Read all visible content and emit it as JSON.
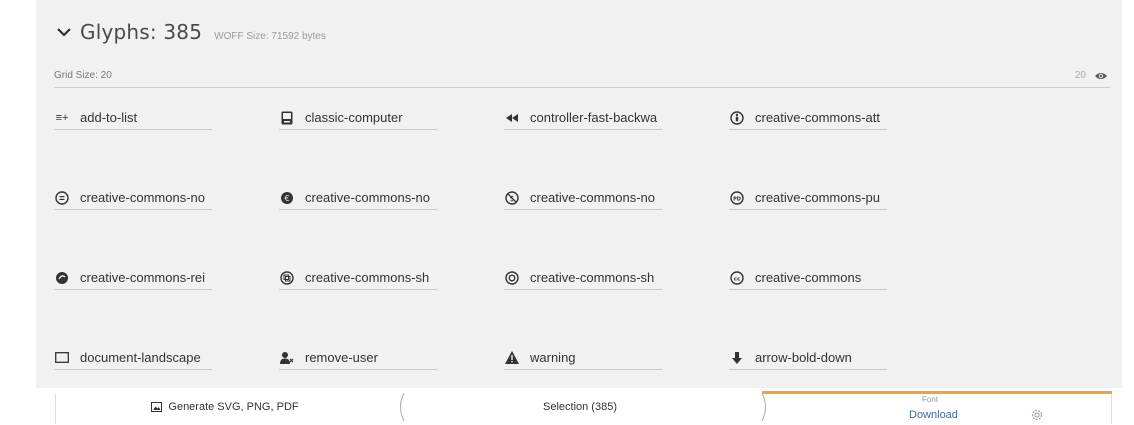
{
  "header": {
    "title": "Glyphs: 385",
    "woff_label": "WOFF Size: 71592 bytes"
  },
  "grid": {
    "label": "Grid Size: 20",
    "value": "20"
  },
  "glyphs": [
    {
      "name": "add-to-list",
      "icon": "add-to-list-icon"
    },
    {
      "name": "classic-computer",
      "icon": "classic-computer-icon"
    },
    {
      "name": "controller-fast-backwa",
      "icon": "controller-fast-backward-icon"
    },
    {
      "name": "creative-commons-att",
      "icon": "creative-commons-attribution-icon"
    },
    {
      "name": "creative-commons-no",
      "icon": "creative-commons-noderivs-icon"
    },
    {
      "name": "creative-commons-no",
      "icon": "creative-commons-noncommercial-eu-icon"
    },
    {
      "name": "creative-commons-no",
      "icon": "creative-commons-noncommercial-us-icon"
    },
    {
      "name": "creative-commons-pu",
      "icon": "creative-commons-public-domain-icon"
    },
    {
      "name": "creative-commons-rei",
      "icon": "creative-commons-remix-icon"
    },
    {
      "name": "creative-commons-sh",
      "icon": "creative-commons-share-icon"
    },
    {
      "name": "creative-commons-sh",
      "icon": "creative-commons-sharealike-icon"
    },
    {
      "name": "creative-commons",
      "icon": "creative-commons-icon"
    },
    {
      "name": "document-landscape",
      "icon": "document-landscape-icon"
    },
    {
      "name": "remove-user",
      "icon": "remove-user-icon"
    },
    {
      "name": "warning",
      "icon": "warning-icon"
    },
    {
      "name": "arrow-bold-down",
      "icon": "arrow-bold-down-icon"
    }
  ],
  "footer": {
    "generate_label": "Generate SVG, PNG, PDF",
    "selection_label": "Selection (385)",
    "font_label": "Font",
    "download_label": "Download"
  },
  "colors": {
    "accent": "#f2a23a",
    "link": "#3e6a9e",
    "panel_bg": "#f1f1f1"
  }
}
